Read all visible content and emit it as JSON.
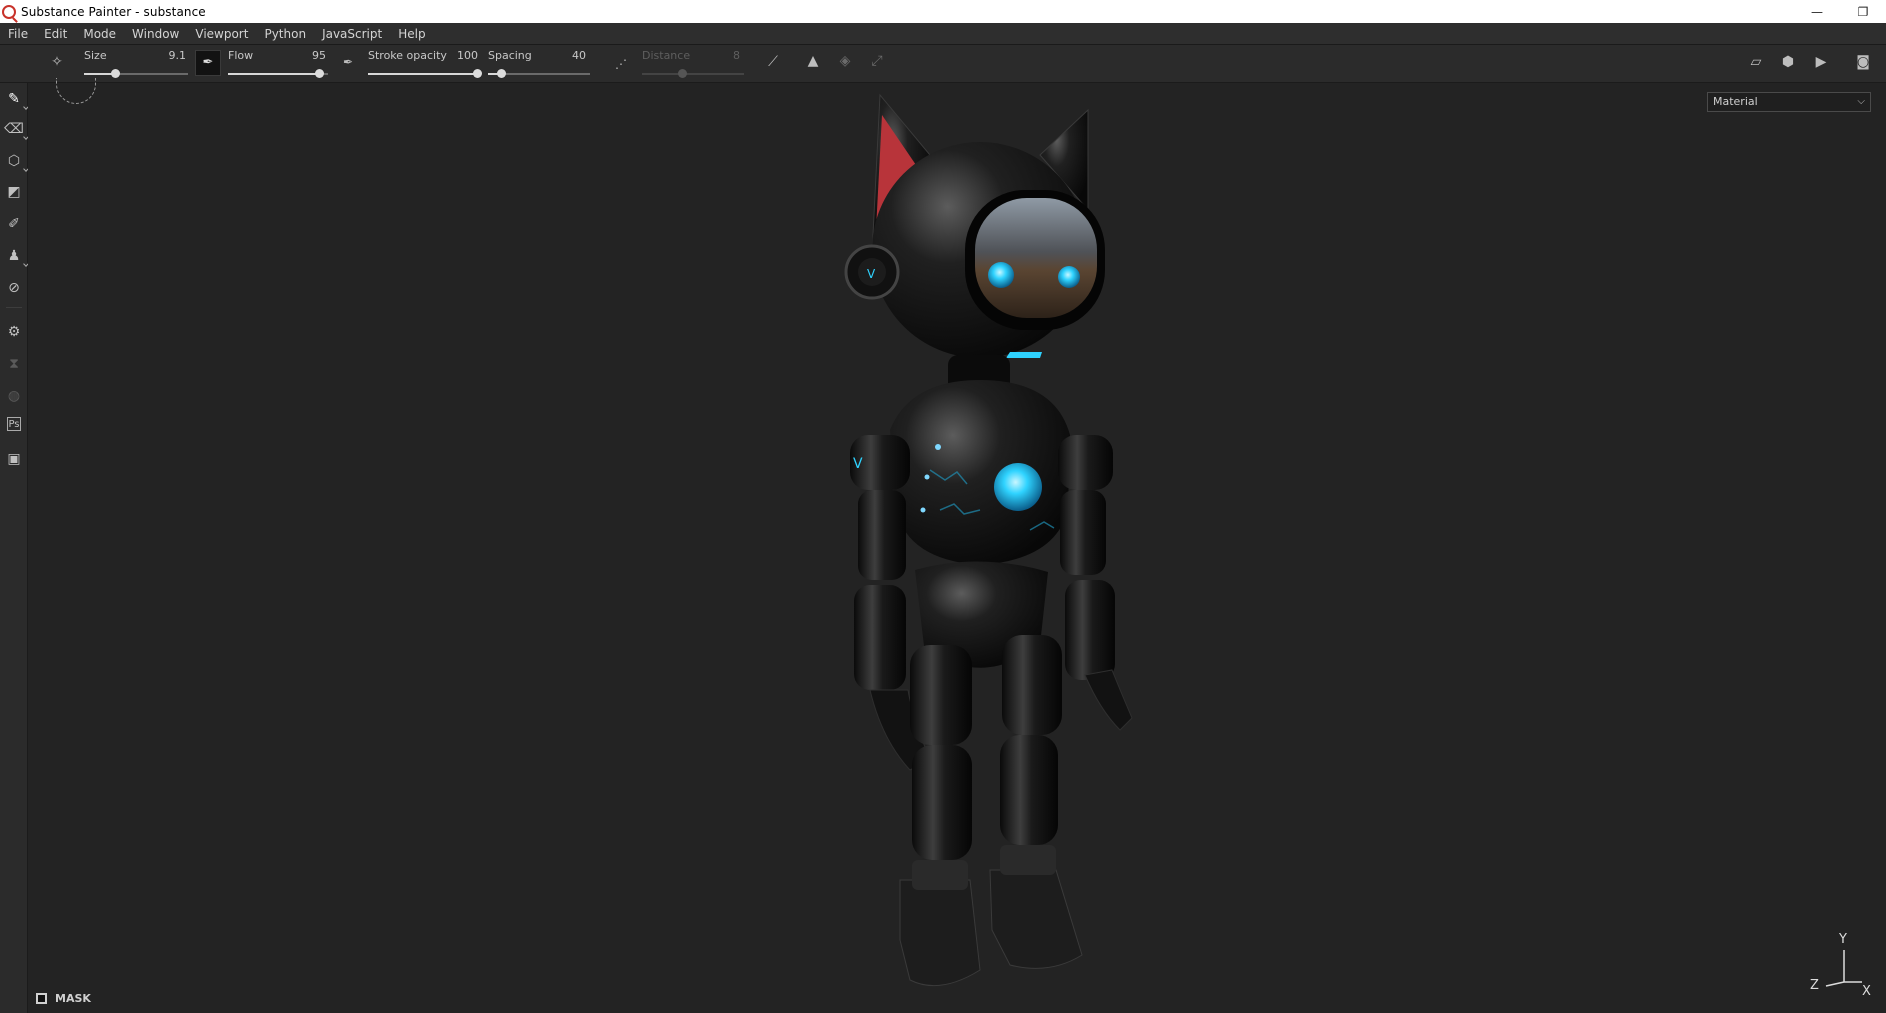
{
  "window": {
    "title": "Substance Painter - substance",
    "controls": {
      "minimize": "—",
      "restore": "❐"
    }
  },
  "menu": [
    "File",
    "Edit",
    "Mode",
    "Window",
    "Viewport",
    "Python",
    "JavaScript",
    "Help"
  ],
  "tool_properties": {
    "size": {
      "label": "Size",
      "value": "9.1",
      "fraction": 0.22
    },
    "flow": {
      "label": "Flow",
      "value": "95",
      "fraction": 0.95
    },
    "stroke_opacity": {
      "label": "Stroke opacity",
      "value": "100",
      "fraction": 1.0
    },
    "spacing": {
      "label": "Spacing",
      "value": "40",
      "fraction": 0.1
    },
    "distance": {
      "label": "Distance",
      "value": "8",
      "fraction": 0.4,
      "disabled": true
    }
  },
  "viewport": {
    "display_mode": "Material",
    "mask_label": "MASK",
    "gizmo": {
      "y": "Y",
      "z": "Z",
      "x": "X"
    }
  },
  "left_tools": [
    "paint-brush-icon",
    "eraser-icon",
    "projection-icon",
    "polygon-fill-icon",
    "smudge-icon",
    "clone-icon",
    "color-picker-icon",
    "bake-icon",
    "hourglass-icon",
    "iray-icon",
    "photoshop-icon",
    "export-icon"
  ],
  "colors": {
    "background": "#232323",
    "panel": "#2b2b2b",
    "accent_glow": "#2fd3ff",
    "ear_inner": "#b8343a"
  }
}
